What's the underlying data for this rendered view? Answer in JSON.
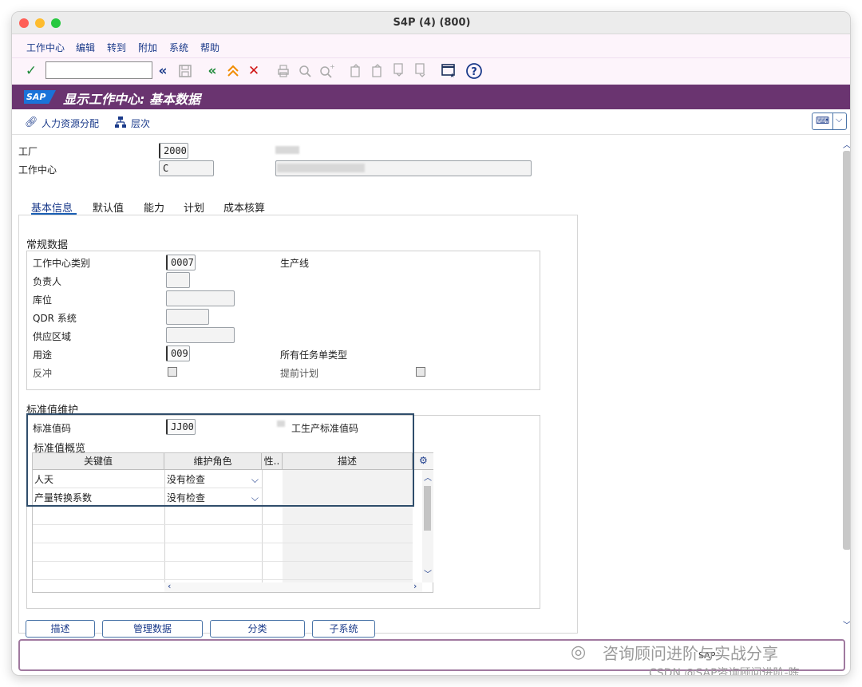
{
  "window": {
    "title": "S4P (4) (800)",
    "traffic_lights": [
      "#ff5f57",
      "#febc2e",
      "#28c840"
    ]
  },
  "menu": [
    "工作中心",
    "编辑",
    "转到",
    "附加",
    "系统",
    "帮助"
  ],
  "toolbar": {
    "command_value": "",
    "icons": [
      "checkmark-icon",
      "back-double-left-icon",
      "save-icon",
      "exit-icon",
      "cancel-icon",
      "print-icon",
      "find-icon",
      "find-next-icon",
      "first-page-icon",
      "prev-page-icon",
      "next-page-icon",
      "last-page-icon",
      "new-session-icon",
      "help-icon"
    ]
  },
  "header": {
    "logo": "SAP",
    "title": "显示工作中心: 基本数据",
    "brand_color": "#6a3470"
  },
  "app_toolbar": {
    "hr_assignment": "人力资源分配",
    "hierarchy": "层次"
  },
  "header_fields": {
    "plant_label": "工厂",
    "plant_value": "2000",
    "workcenter_label": "工作中心",
    "workcenter_value": "C"
  },
  "tabs": [
    "基本信息",
    "默认值",
    "能力",
    "计划",
    "成本核算"
  ],
  "general": {
    "title": "常规数据",
    "category_label": "工作中心类别",
    "category_value": "0007",
    "category_desc": "生产线",
    "person_label": "负责人",
    "location_label": "库位",
    "qdr_label": "QDR 系统",
    "supply_label": "供应区域",
    "usage_label": "用途",
    "usage_value": "009",
    "usage_desc": "所有任务单类型",
    "backflush_label": "反冲",
    "advance_label": "提前计划"
  },
  "standard": {
    "title": "标准值维护",
    "key_label": "标准值码",
    "key_value": "JJ00",
    "key_desc": "工生产标准值码",
    "overview_title": "标准值概览",
    "columns": [
      "关键值",
      "维护角色",
      "性..",
      "描述"
    ],
    "rows": [
      {
        "key": "人天",
        "role": "没有检查"
      },
      {
        "key": "产量转换系数",
        "role": "没有检查"
      }
    ]
  },
  "bottom_buttons": [
    "描述",
    "管理数据",
    "分类",
    "子系统"
  ],
  "status": {
    "sap": "SAP",
    "watermark_1": "咨询顾问进阶与实战分享",
    "watermark_2": "CSDN @SAP咨询顾问进阶-陈"
  }
}
